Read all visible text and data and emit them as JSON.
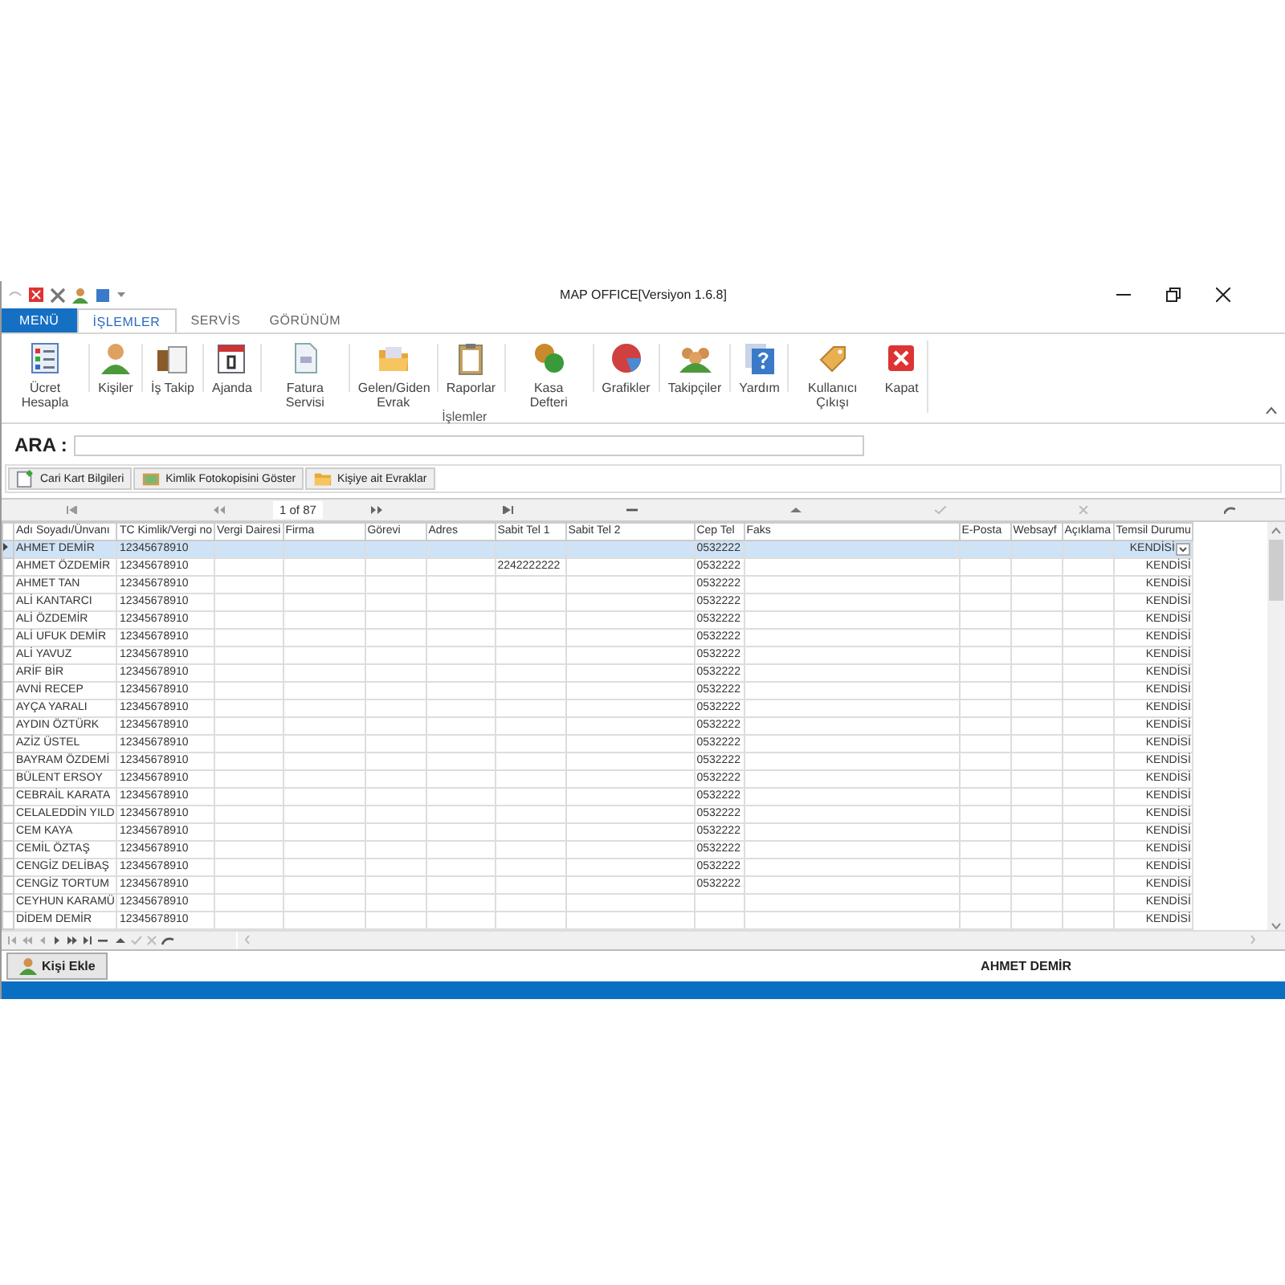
{
  "window": {
    "title": "MAP OFFICE[Versiyon 1.6.8]"
  },
  "tabs": [
    {
      "label": "MENÜ",
      "selected": false,
      "kind": "file"
    },
    {
      "label": "İŞLEMLER",
      "selected": true,
      "kind": "tab"
    },
    {
      "label": "SERVİS",
      "selected": false,
      "kind": "tab"
    },
    {
      "label": "GÖRÜNÜM",
      "selected": false,
      "kind": "tab"
    }
  ],
  "ribbon": {
    "group": "İşlemler",
    "buttons": [
      {
        "label": "Ücret Hesapla"
      },
      {
        "label": "Kişiler"
      },
      {
        "label": "İş Takip"
      },
      {
        "label": "Ajanda"
      },
      {
        "label": "Fatura Servisi"
      },
      {
        "label": "Gelen/Giden Evrak"
      },
      {
        "label": "Raporlar"
      },
      {
        "label": "Kasa Defteri"
      },
      {
        "label": "Grafikler"
      },
      {
        "label": "Takipçiler"
      },
      {
        "label": "Yardım"
      },
      {
        "label": "Kullanıcı Çıkışı"
      },
      {
        "label": "Kapat"
      }
    ]
  },
  "search": {
    "label": "ARA :"
  },
  "actions": [
    "Cari Kart Bilgileri",
    "Kimlik Fotokopisini Göster",
    "Kişiye ait Evraklar"
  ],
  "navigator": {
    "position": "1 of 87"
  },
  "table": {
    "columns": [
      "Adı Soyadı/Ünvanı",
      "TC Kimlik/Vergi no",
      "Vergi Dairesi",
      "Firma",
      "Görevi",
      "Adres",
      "Sabit Tel 1",
      "Sabit Tel 2",
      "Cep Tel",
      "Faks",
      "E-Posta",
      "Websayf",
      "Açıklama",
      "Temsil Durumu"
    ],
    "rows": [
      {
        "adi_soyadi": "AHMET DEMİR",
        "tc_kimlik": "12345678910",
        "cep_tel": "0532222",
        "temsil_durumu": "KENDİSİ",
        "selected": true
      },
      {
        "adi_soyadi": "AHMET ÖZDEMİR",
        "tc_kimlik": "12345678910",
        "sabit_tel_1": "2242222222",
        "cep_tel": "0532222",
        "temsil_durumu": "KENDİSİ",
        "selected": false
      },
      {
        "adi_soyadi": "AHMET TAN",
        "tc_kimlik": "12345678910",
        "cep_tel": "0532222",
        "temsil_durumu": "KENDİSİ",
        "selected": false
      },
      {
        "adi_soyadi": "ALİ KANTARCI",
        "tc_kimlik": "12345678910",
        "cep_tel": "0532222",
        "temsil_durumu": "KENDİSİ",
        "selected": false
      },
      {
        "adi_soyadi": "ALİ ÖZDEMİR",
        "tc_kimlik": "12345678910",
        "cep_tel": "0532222",
        "temsil_durumu": "KENDİSİ",
        "selected": false
      },
      {
        "adi_soyadi": "ALİ UFUK DEMİR",
        "tc_kimlik": "12345678910",
        "cep_tel": "0532222",
        "temsil_durumu": "KENDİSİ",
        "selected": false
      },
      {
        "adi_soyadi": "ALİ YAVUZ",
        "tc_kimlik": "12345678910",
        "cep_tel": "0532222",
        "temsil_durumu": "KENDİSİ",
        "selected": false
      },
      {
        "adi_soyadi": "ARİF BİR",
        "tc_kimlik": "12345678910",
        "cep_tel": "0532222",
        "temsil_durumu": "KENDİSİ",
        "selected": false
      },
      {
        "adi_soyadi": "AVNİ RECEP",
        "tc_kimlik": "12345678910",
        "cep_tel": "0532222",
        "temsil_durumu": "KENDİSİ",
        "selected": false
      },
      {
        "adi_soyadi": "AYÇA YARALI",
        "tc_kimlik": "12345678910",
        "cep_tel": "0532222",
        "temsil_durumu": "KENDİSİ",
        "selected": false
      },
      {
        "adi_soyadi": "AYDIN ÖZTÜRK",
        "tc_kimlik": "12345678910",
        "cep_tel": "0532222",
        "temsil_durumu": "KENDİSİ",
        "selected": false
      },
      {
        "adi_soyadi": "AZİZ ÜSTEL",
        "tc_kimlik": "12345678910",
        "cep_tel": "0532222",
        "temsil_durumu": "KENDİSİ",
        "selected": false
      },
      {
        "adi_soyadi": "BAYRAM ÖZDEMİ",
        "tc_kimlik": "12345678910",
        "cep_tel": "0532222",
        "temsil_durumu": "KENDİSİ",
        "selected": false
      },
      {
        "adi_soyadi": "BÜLENT ERSOY",
        "tc_kimlik": "12345678910",
        "cep_tel": "0532222",
        "temsil_durumu": "KENDİSİ",
        "selected": false
      },
      {
        "adi_soyadi": "CEBRAİL KARATA",
        "tc_kimlik": "12345678910",
        "cep_tel": "0532222",
        "temsil_durumu": "KENDİSİ",
        "selected": false
      },
      {
        "adi_soyadi": "CELALEDDİN YILD",
        "tc_kimlik": "12345678910",
        "cep_tel": "0532222",
        "temsil_durumu": "KENDİSİ",
        "selected": false
      },
      {
        "adi_soyadi": "CEM KAYA",
        "tc_kimlik": "12345678910",
        "cep_tel": "0532222",
        "temsil_durumu": "KENDİSİ",
        "selected": false
      },
      {
        "adi_soyadi": "CEMİL ÖZTAŞ",
        "tc_kimlik": "12345678910",
        "cep_tel": "0532222",
        "temsil_durumu": "KENDİSİ",
        "selected": false
      },
      {
        "adi_soyadi": "CENGİZ DELİBAŞ",
        "tc_kimlik": "12345678910",
        "cep_tel": "0532222",
        "temsil_durumu": "KENDİSİ",
        "selected": false
      },
      {
        "adi_soyadi": "CENGİZ TORTUM",
        "tc_kimlik": "12345678910",
        "cep_tel": "0532222",
        "temsil_durumu": "KENDİSİ",
        "selected": false
      },
      {
        "adi_soyadi": "CEYHUN KARAMÜ",
        "tc_kimlik": "12345678910",
        "temsil_durumu": "KENDİSİ",
        "selected": false
      },
      {
        "adi_soyadi": "DİDEM DEMİR",
        "tc_kimlik": "12345678910",
        "temsil_durumu": "KENDİSİ",
        "selected": false
      }
    ]
  },
  "add_button": {
    "label": "Kişi Ekle"
  },
  "status": {
    "current_person": "AHMET DEMİR"
  }
}
